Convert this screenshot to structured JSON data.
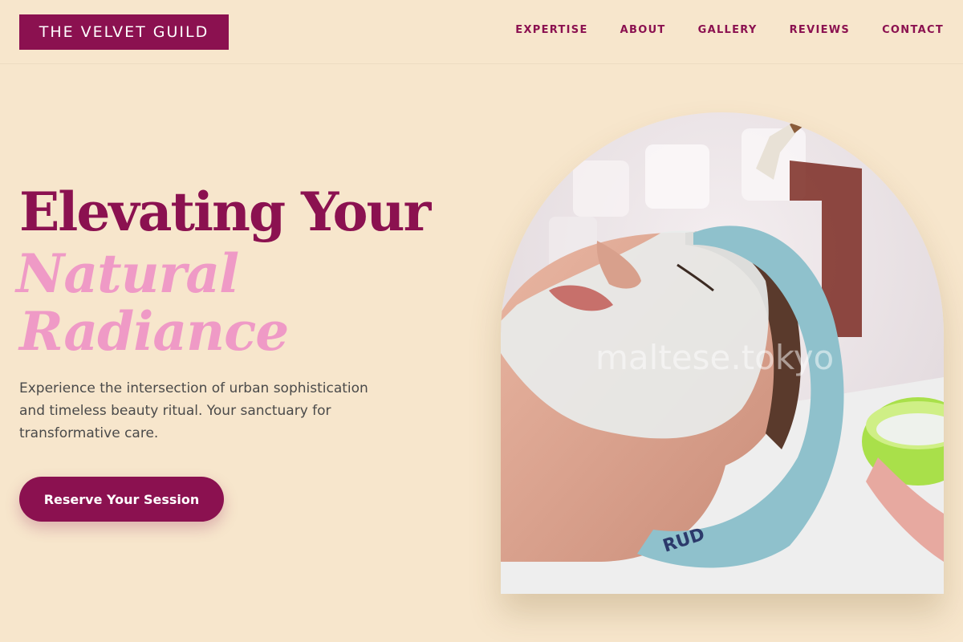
{
  "brand": {
    "name": "THE VELVET GUILD"
  },
  "nav": {
    "items": [
      {
        "label": "EXPERTISE"
      },
      {
        "label": "ABOUT"
      },
      {
        "label": "GALLERY"
      },
      {
        "label": "REVIEWS"
      },
      {
        "label": "CONTACT"
      }
    ]
  },
  "hero": {
    "title_line1": "Elevating Your",
    "title_line2": "Natural",
    "title_line3": "Radiance",
    "description": "Experience the intersection of urban sophistication and timeless beauty ritual. Your sanctuary for transformative care.",
    "cta_label": "Reserve Your Session",
    "image": {
      "watermark": "maltese.tokyo",
      "headband_text": "RUD"
    }
  },
  "colors": {
    "background": "#f7e6cc",
    "brand": "#8b1150",
    "accent": "#ef9ac6",
    "body_text": "#4a4a4a"
  }
}
